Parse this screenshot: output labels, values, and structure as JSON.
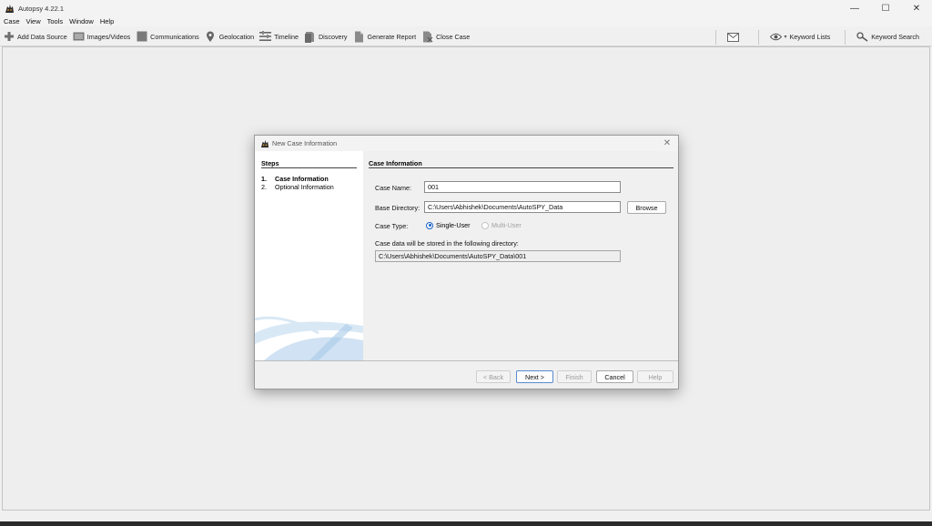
{
  "window": {
    "title": "Autopsy 4.22.1",
    "controls": {
      "minimize": "—",
      "maximize": "☐",
      "close": "✕"
    }
  },
  "menu": [
    "Case",
    "View",
    "Tools",
    "Window",
    "Help"
  ],
  "toolbar": {
    "add_data_source": "Add Data Source",
    "images_videos": "Images/Videos",
    "communications": "Communications",
    "geolocation": "Geolocation",
    "timeline": "Timeline",
    "discovery": "Discovery",
    "generate_report": "Generate Report",
    "close_case": "Close Case",
    "keyword_lists": "Keyword Lists",
    "keyword_search": "Keyword Search"
  },
  "dialog": {
    "title": "New Case Information",
    "close": "✕",
    "steps": {
      "header": "Steps",
      "items": [
        {
          "num": "1.",
          "label": "Case Information"
        },
        {
          "num": "2.",
          "label": "Optional Information"
        }
      ]
    },
    "content": {
      "header": "Case Information",
      "case_name_label": "Case Name:",
      "case_name_value": "001",
      "base_dir_label": "Base Directory:",
      "base_dir_value": "C:\\Users\\Abhishek\\Documents\\AutoSPY_Data",
      "browse_label": "Browse",
      "case_type_label": "Case Type:",
      "single_user_label": "Single-User",
      "multi_user_label": "Multi-User",
      "stored_note": "Case data will be stored in the following directory:",
      "stored_path": "C:\\Users\\Abhishek\\Documents\\AutoSPY_Data\\001"
    },
    "buttons": {
      "back": "< Back",
      "next": "Next >",
      "finish": "Finish",
      "cancel": "Cancel",
      "help": "Help"
    }
  },
  "colors": {
    "accent": "#1a63c6",
    "dialog_bg": "#f0f0f0",
    "steps_bg": "#ffffff"
  }
}
